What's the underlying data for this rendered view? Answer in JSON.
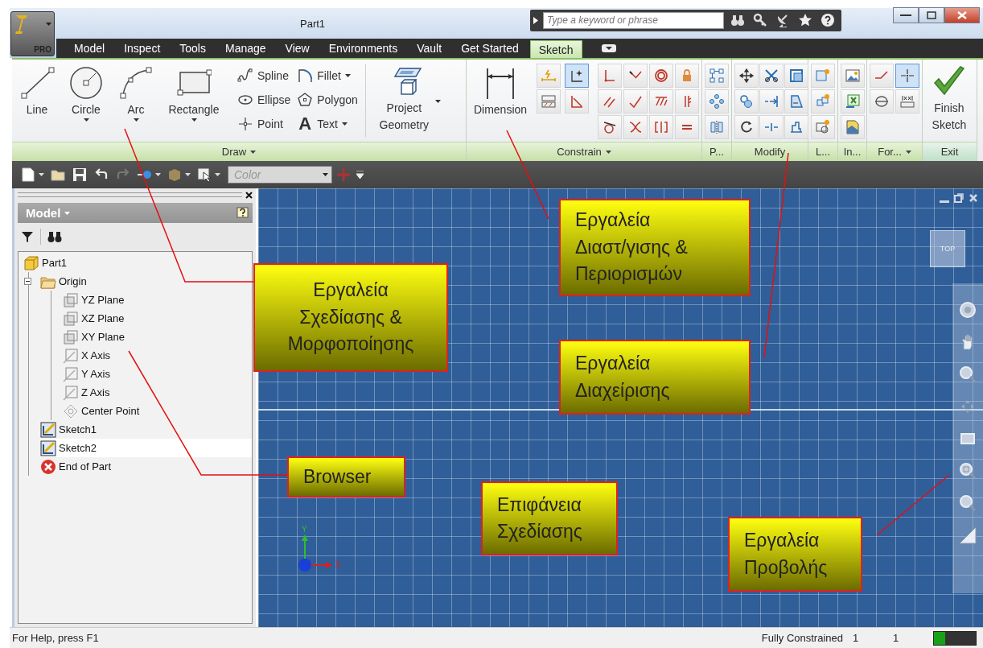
{
  "window": {
    "title": "Part1",
    "logo_text": "PRO"
  },
  "search": {
    "placeholder": "Type a keyword or phrase"
  },
  "tabs": [
    {
      "label": "Model",
      "selected": false
    },
    {
      "label": "Inspect",
      "selected": false
    },
    {
      "label": "Tools",
      "selected": false
    },
    {
      "label": "Manage",
      "selected": false
    },
    {
      "label": "View",
      "selected": false
    },
    {
      "label": "Environments",
      "selected": false
    },
    {
      "label": "Vault",
      "selected": false
    },
    {
      "label": "Get Started",
      "selected": false
    },
    {
      "label": "Sketch",
      "selected": true
    }
  ],
  "ribbon": {
    "draw_large": [
      {
        "label": "Line",
        "menu": false
      },
      {
        "label": "Circle",
        "menu": true
      },
      {
        "label": "Arc",
        "menu": true
      },
      {
        "label": "Rectangle",
        "menu": true
      }
    ],
    "draw_small": [
      {
        "label": "Spline",
        "menu": false
      },
      {
        "label": "Ellipse",
        "menu": false
      },
      {
        "label": "Point",
        "menu": false
      },
      {
        "label": "Fillet",
        "menu": true
      },
      {
        "label": "Polygon",
        "menu": false
      },
      {
        "label": "Text",
        "menu": true,
        "icon_char": "A"
      }
    ],
    "project_geometry": {
      "label": "Project Geometry",
      "menu": true
    },
    "dimension": {
      "label": "Dimension"
    },
    "constrain_toggles": [
      {
        "on": false
      },
      {
        "on": true
      },
      {
        "on": false
      },
      {
        "on": false
      }
    ],
    "format_toggles": [
      {
        "on": false
      },
      {
        "on": true
      },
      {
        "on": false
      },
      {
        "on": false
      }
    ],
    "finish": {
      "label": "Finish Sketch"
    },
    "panels": [
      {
        "label": "Draw",
        "menu": true
      },
      {
        "label": "Constrain",
        "menu": true
      },
      {
        "label": "P...",
        "menu": false
      },
      {
        "label": "Modify",
        "menu": false
      },
      {
        "label": "L...",
        "menu": false
      },
      {
        "label": "In...",
        "menu": false
      },
      {
        "label": "For...",
        "menu": true
      },
      {
        "label": "Exit",
        "menu": false
      }
    ]
  },
  "toolbar": {
    "color_field": {
      "placeholder": "Color"
    }
  },
  "browser": {
    "title": "Model",
    "tree": [
      {
        "label": "Part1",
        "kind": "part",
        "selected": false,
        "children": [
          {
            "label": "Origin",
            "kind": "folder",
            "selected": false,
            "expanded": true,
            "children": [
              {
                "label": "YZ Plane",
                "kind": "plane",
                "selected": false
              },
              {
                "label": "XZ Plane",
                "kind": "plane",
                "selected": false
              },
              {
                "label": "XY Plane",
                "kind": "plane",
                "selected": false
              },
              {
                "label": "X Axis",
                "kind": "axis",
                "selected": false
              },
              {
                "label": "Y Axis",
                "kind": "axis",
                "selected": false
              },
              {
                "label": "Z Axis",
                "kind": "axis",
                "selected": false
              },
              {
                "label": "Center Point",
                "kind": "point",
                "selected": false
              }
            ]
          },
          {
            "label": "Sketch1",
            "kind": "sketch",
            "selected": false
          },
          {
            "label": "Sketch2",
            "kind": "sketch",
            "selected": true
          },
          {
            "label": "End of Part",
            "kind": "end",
            "selected": false
          }
        ]
      }
    ]
  },
  "canvas": {
    "viewcube": "TOP",
    "axis_x": "X",
    "axis_y": "Y"
  },
  "callouts": [
    {
      "text": "Εργαλεία\nΣχεδίασης &\nΜορφοποίησης"
    },
    {
      "text": "Εργαλεία\nΔιαστ/γισης &\nΠεριορισμών"
    },
    {
      "text": "Εργαλεία\nΔιαχείρισης"
    },
    {
      "text": "Browser"
    },
    {
      "text": "Επιφάνεια\nΣχεδίασης"
    },
    {
      "text": "Εργαλεία\nΠροβολής"
    }
  ],
  "status_bar": {
    "help": "For Help, press F1",
    "state": "Fully Constrained",
    "values": [
      "1",
      "1"
    ]
  }
}
